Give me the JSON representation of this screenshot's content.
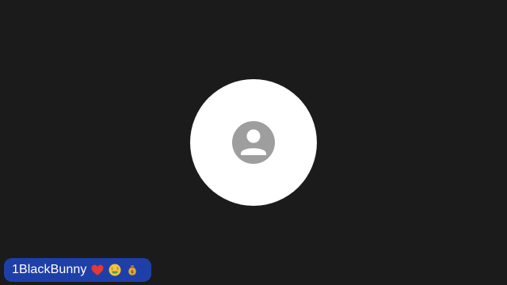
{
  "participant": {
    "name": "1BlackBunny",
    "emojis": [
      "red-heart",
      "money-mouth-face",
      "money-bag"
    ]
  },
  "colors": {
    "background": "#1b1b1b",
    "avatar_circle": "#ffffff",
    "avatar_icon": "#9e9e9e",
    "name_tag": "#1f3fa8"
  },
  "icons": {
    "avatar": "person-icon"
  }
}
